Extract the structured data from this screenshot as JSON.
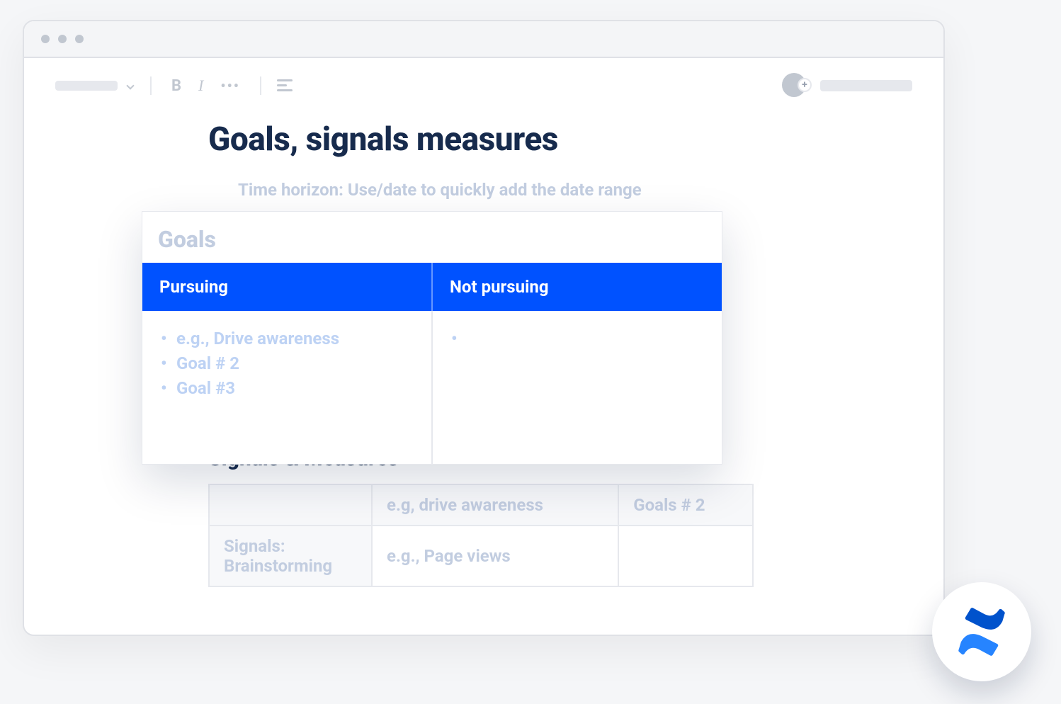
{
  "toolbar": {
    "bold": "B",
    "italic": "I",
    "more": "•••"
  },
  "header": {
    "avatar_plus": "+"
  },
  "page": {
    "title": "Goals, signals measures",
    "hint": "Time horizon: Use/date to quickly add the date range"
  },
  "goals_panel": {
    "title": "Goals",
    "columns": {
      "pursuing": "Pursuing",
      "not_pursuing": "Not pursuing"
    },
    "pursuing_items": [
      "e.g., Drive awareness",
      "Goal # 2",
      "Goal #3"
    ],
    "not_pursuing_items": [
      ""
    ]
  },
  "signals": {
    "heading": "Signals & Measures",
    "headers": {
      "col1": "",
      "col2": "e.g, drive awareness",
      "col3": "Goals # 2"
    },
    "row1": {
      "label": "Signals: Brainstorming",
      "c2": "e.g., Page views",
      "c3": ""
    }
  }
}
